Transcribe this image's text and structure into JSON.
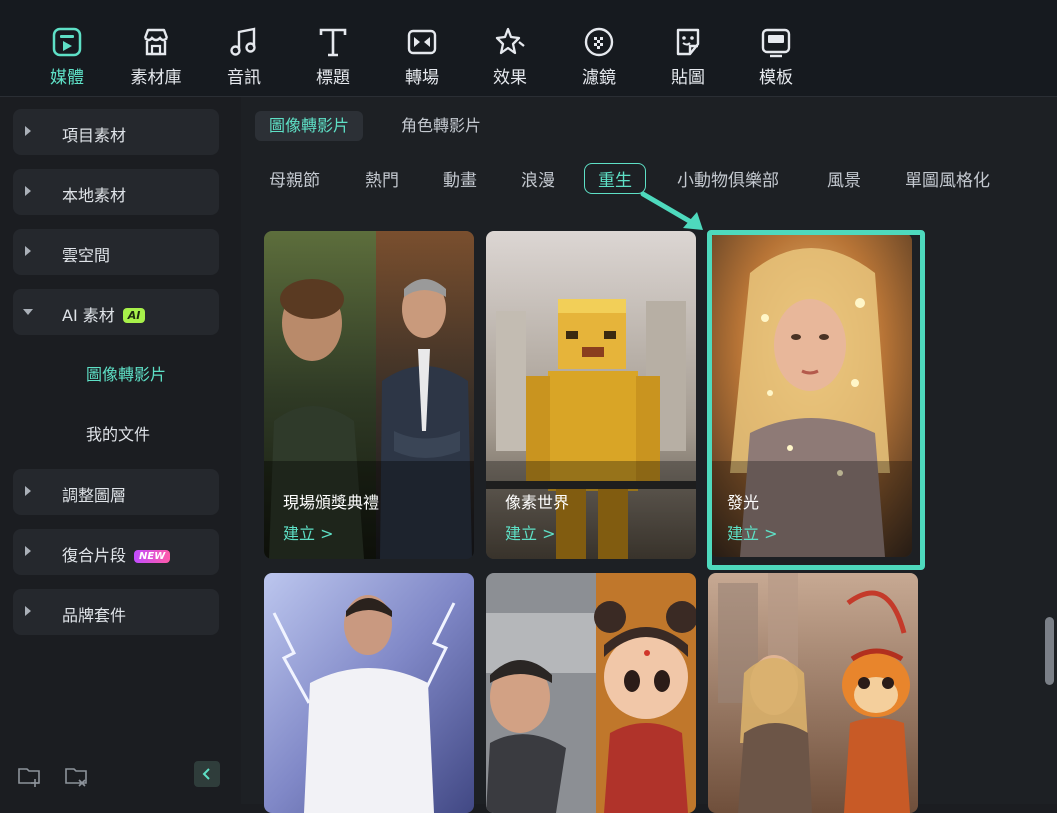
{
  "toolbar": {
    "items": [
      {
        "label": "媒體",
        "icon": "media-icon",
        "active": true
      },
      {
        "label": "素材庫",
        "icon": "store-icon"
      },
      {
        "label": "音訊",
        "icon": "music-note-icon"
      },
      {
        "label": "標題",
        "icon": "text-t-icon"
      },
      {
        "label": "轉場",
        "icon": "transition-icon"
      },
      {
        "label": "效果",
        "icon": "effects-star-icon"
      },
      {
        "label": "濾鏡",
        "icon": "filter-icon"
      },
      {
        "label": "貼圖",
        "icon": "sticker-icon"
      },
      {
        "label": "模板",
        "icon": "template-icon"
      }
    ]
  },
  "sidebar": {
    "items": [
      {
        "label": "項目素材",
        "expanded": false
      },
      {
        "label": "本地素材",
        "expanded": false
      },
      {
        "label": "雲空間",
        "expanded": false
      },
      {
        "label": "AI 素材",
        "expanded": true,
        "badge": "AI"
      },
      {
        "label": "調整圖層",
        "expanded": false
      },
      {
        "label": "復合片段",
        "expanded": false,
        "badge": "NEW"
      },
      {
        "label": "品牌套件",
        "expanded": false
      }
    ],
    "subitems": [
      {
        "label": "圖像轉影片",
        "active": true
      },
      {
        "label": "我的文件"
      }
    ]
  },
  "main": {
    "subtabs": [
      {
        "label": "圖像轉影片",
        "active": true
      },
      {
        "label": "角色轉影片"
      }
    ],
    "categories": [
      {
        "label": "母親節"
      },
      {
        "label": "熱門"
      },
      {
        "label": "動畫"
      },
      {
        "label": "浪漫"
      },
      {
        "label": "重生",
        "active": true
      },
      {
        "label": "小動物俱樂部"
      },
      {
        "label": "風景"
      },
      {
        "label": "單圖風格化"
      }
    ],
    "cards": [
      {
        "title": "現場頒獎典禮",
        "action": "建立 >"
      },
      {
        "title": "像素世界",
        "action": "建立 >"
      },
      {
        "title": "發光",
        "action": "建立 >",
        "highlighted": true
      },
      {
        "title": "",
        "action": ""
      },
      {
        "title": "",
        "action": ""
      },
      {
        "title": "",
        "action": ""
      }
    ]
  },
  "colors": {
    "accent": "#5ee0c6",
    "highlight": "#4ed9bd",
    "ai_badge": "#a7f04a"
  }
}
